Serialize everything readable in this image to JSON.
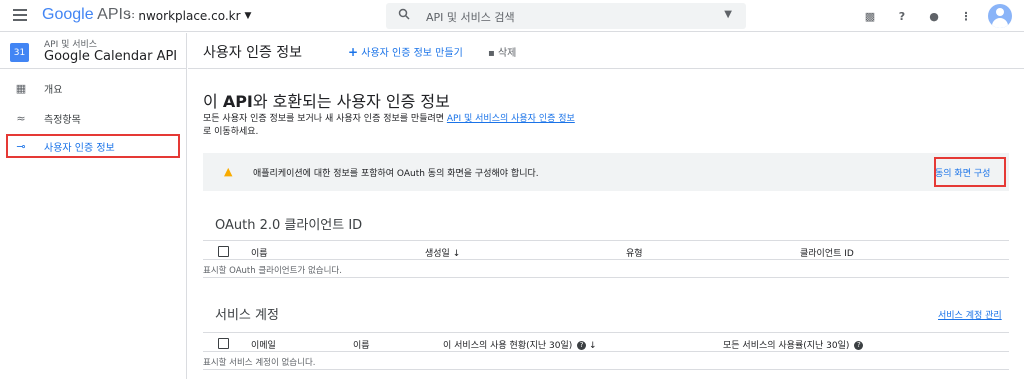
{
  "topbar": {
    "logo_google": "Google",
    "logo_apis": "APIs",
    "project_name": "nworkplace.co.kr",
    "search_placeholder": "API 및 서비스 검색"
  },
  "sidebar": {
    "calendar_icon_text": "31",
    "api_section": "API 및 서비스",
    "api_name": "Google Calendar API",
    "items": [
      {
        "label": "개요",
        "icon": "dashboard-icon"
      },
      {
        "label": "측정항목",
        "icon": "metrics-icon"
      },
      {
        "label": "사용자 인증 정보",
        "icon": "key-icon"
      }
    ]
  },
  "header": {
    "title": "사용자 인증 정보",
    "create_label": "사용자 인증 정보 만들기",
    "delete_label": "삭제"
  },
  "main": {
    "heading_prefix": "이 ",
    "heading_bold": "API",
    "heading_suffix": "와 호환되는 사용자 인증 정보",
    "desc_text": "모든 사용자 인증 정보를 보거나 새 사용자 인증 정보를 만들려면 ",
    "desc_link": "API 및 서비스의 사용자 인증 정보",
    "desc_after": "로 이동하세요.",
    "banner_text": "애플리케이션에 대한 정보를 포함하여 OAuth 동의 화면을 구성해야 합니다.",
    "banner_action": "동의 화면 구성"
  },
  "oauth": {
    "title": "OAuth 2.0 클라이언트 ID",
    "columns": [
      "이름",
      "생성일",
      "유형",
      "클라이언트 ID"
    ],
    "empty": "표시할 OAuth 클라이언트가 없습니다."
  },
  "service": {
    "title": "서비스 계정",
    "manage": "서비스 계정 관리",
    "columns": [
      "이메일",
      "이름",
      "이 서비스의 사용 현황(지난 30일)",
      "모든 서비스의 사용률(지난 30일)"
    ],
    "empty": "표시할 서비스 계정이 없습니다."
  },
  "colors": {
    "accent": "#1a73e8",
    "highlight": "#e53935",
    "warning": "#f9ab00"
  }
}
